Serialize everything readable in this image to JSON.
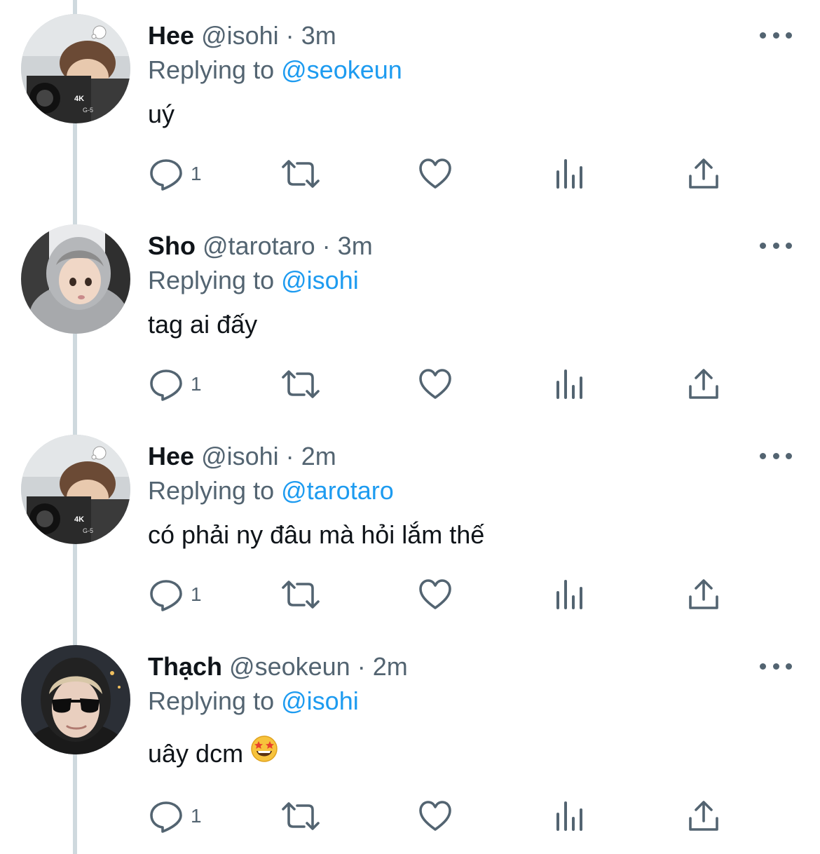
{
  "colors": {
    "text": "#0f1419",
    "secondary": "#536471",
    "accent": "#1d9bf0",
    "thread_line": "#cfd9de",
    "background": "#ffffff"
  },
  "icons": {
    "more": "more-horizontal-icon",
    "reply": "reply-icon",
    "retweet": "retweet-icon",
    "like": "heart-icon",
    "views": "views-bar-chart-icon",
    "share": "share-upload-icon"
  },
  "tweets": [
    {
      "display_name": "Hee",
      "handle": "@isohi",
      "separator": "·",
      "time": "3m",
      "replying_prefix": "Replying to",
      "replying_to": "@seokeun",
      "text": "uý",
      "reply_count": "1"
    },
    {
      "display_name": "Sho",
      "handle": "@tarotaro",
      "separator": "·",
      "time": "3m",
      "replying_prefix": "Replying to",
      "replying_to": "@isohi",
      "text": "tag ai đấy",
      "reply_count": "1"
    },
    {
      "display_name": "Hee",
      "handle": "@isohi",
      "separator": "·",
      "time": "2m",
      "replying_prefix": "Replying to",
      "replying_to": "@tarotaro",
      "text": "có phải ny đâu mà hỏi lắm thế",
      "reply_count": "1"
    },
    {
      "display_name": "Thạch",
      "handle": "@seokeun",
      "separator": "·",
      "time": "2m",
      "replying_prefix": "Replying to",
      "replying_to": "@isohi",
      "text": "uây dcm",
      "emoji": "star-struck-emoji",
      "reply_count": "1"
    }
  ]
}
